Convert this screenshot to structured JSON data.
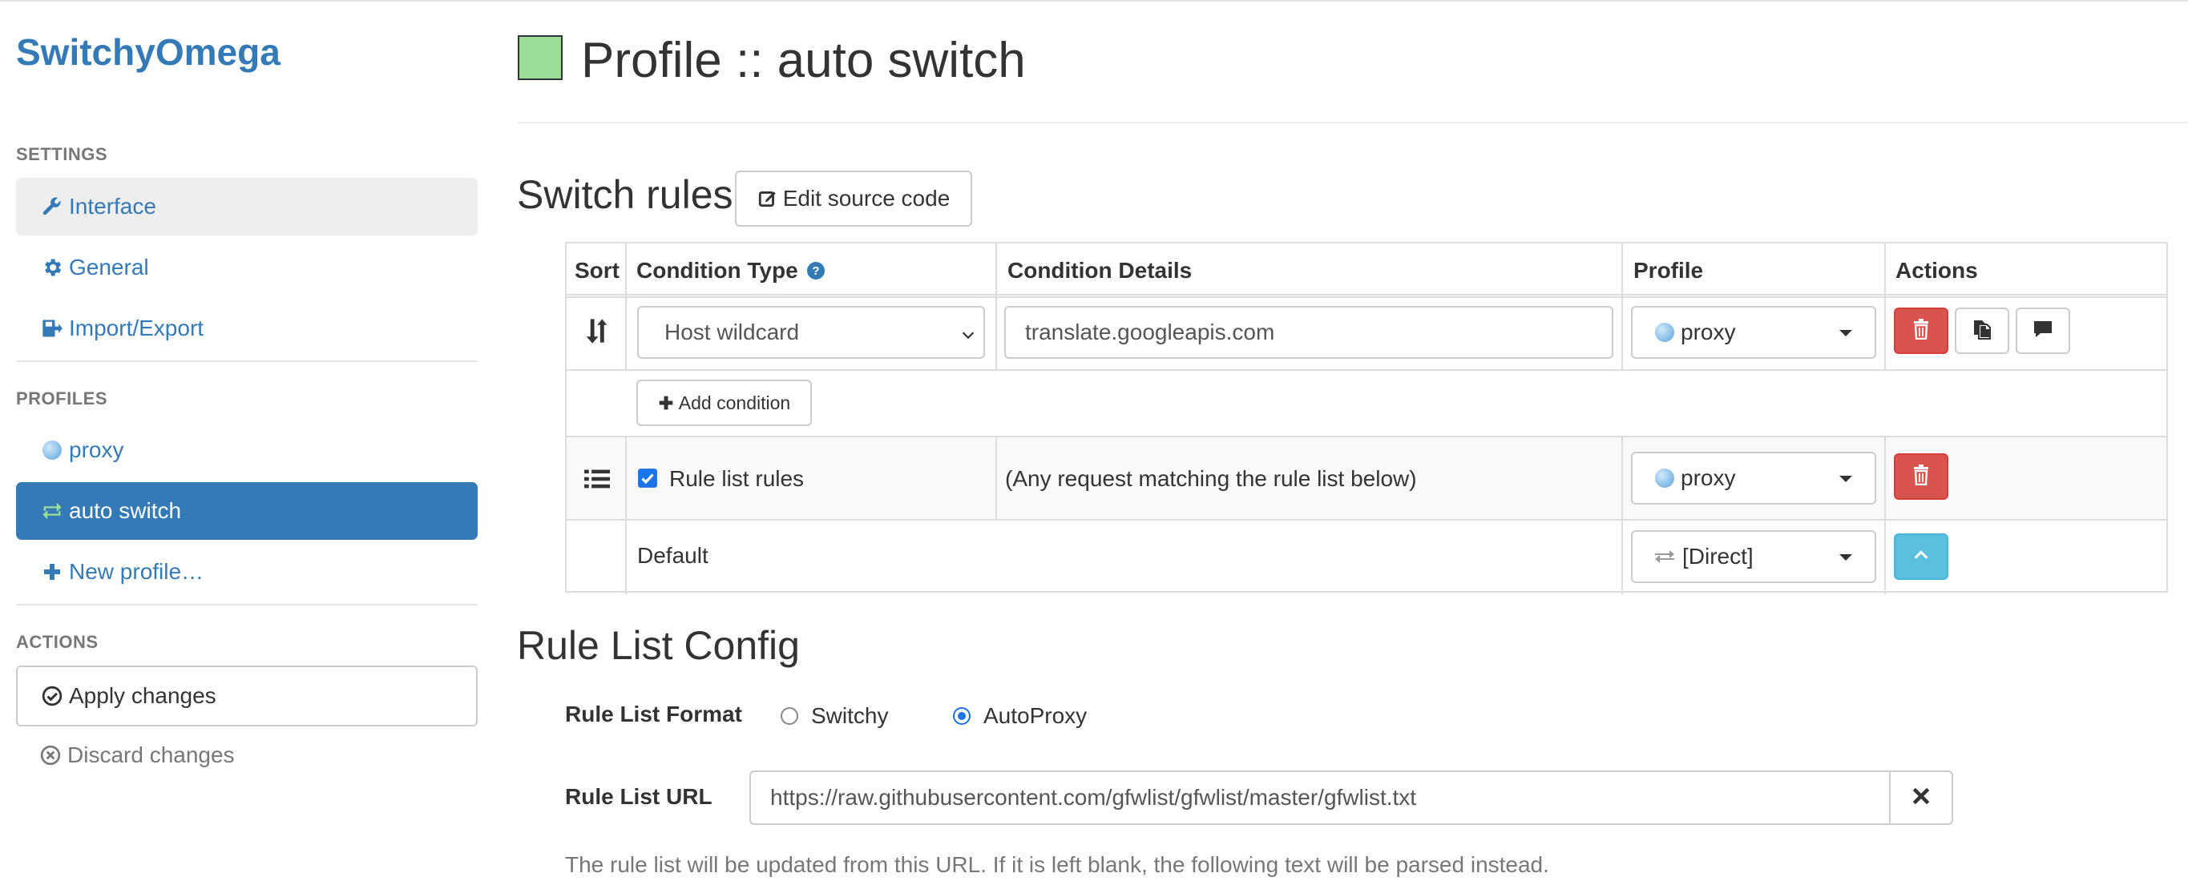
{
  "app": {
    "brand": "SwitchyOmega"
  },
  "sidebar": {
    "settings_header": "SETTINGS",
    "settings_items": [
      {
        "label": "Interface",
        "icon": "wrench-icon"
      },
      {
        "label": "General",
        "icon": "gear-icon"
      },
      {
        "label": "Import/Export",
        "icon": "import-export-icon"
      }
    ],
    "profiles_header": "PROFILES",
    "profiles_items": [
      {
        "label": "proxy",
        "icon": "globe-icon"
      },
      {
        "label": "auto switch",
        "icon": "switch-arrows-icon",
        "active": true
      },
      {
        "label": "New profile…",
        "icon": "plus-icon"
      }
    ],
    "actions_header": "ACTIONS",
    "apply_label": "Apply changes",
    "discard_label": "Discard changes"
  },
  "page": {
    "title": "Profile :: auto switch",
    "profile_color": "#99dd99"
  },
  "switch_rules": {
    "heading": "Switch rules",
    "edit_source_label": "Edit source code",
    "columns": {
      "sort": "Sort",
      "condition_type": "Condition Type",
      "condition_details": "Condition Details",
      "profile": "Profile",
      "actions": "Actions"
    },
    "rule": {
      "condition_type": "Host wildcard",
      "condition_details": "translate.googleapis.com",
      "profile": "proxy"
    },
    "add_condition_label": "Add condition",
    "rule_list_row": {
      "checked": true,
      "label": "Rule list rules",
      "details": "(Any request matching the rule list below)",
      "profile": "proxy"
    },
    "default_row": {
      "label": "Default",
      "profile": "[Direct]"
    }
  },
  "rule_list_config": {
    "heading": "Rule List Config",
    "format_label": "Rule List Format",
    "format_options": [
      "Switchy",
      "AutoProxy"
    ],
    "format_selected": "AutoProxy",
    "url_label": "Rule List URL",
    "url_value": "https://raw.githubusercontent.com/gfwlist/gfwlist/master/gfwlist.txt",
    "help_text": "The rule list will be updated from this URL. If it is left blank, the following text will be parsed instead."
  },
  "colors": {
    "primary": "#337ab7",
    "danger": "#d9534f",
    "info": "#5bc0de"
  }
}
